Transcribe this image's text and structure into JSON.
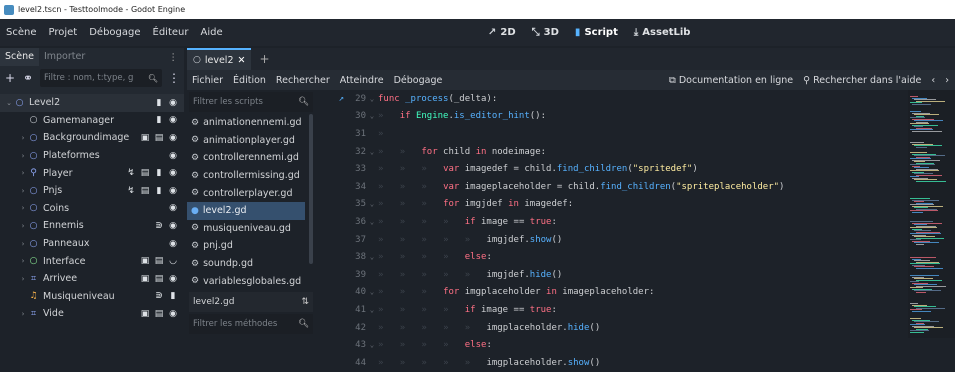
{
  "window": {
    "title": "level2.tscn - Testtoolmode - Godot Engine"
  },
  "menu": [
    "Scène",
    "Projet",
    "Débogage",
    "Éditeur",
    "Aide"
  ],
  "main_screens": [
    {
      "label": "2D",
      "icon": "2d-icon"
    },
    {
      "label": "3D",
      "icon": "3d-icon"
    },
    {
      "label": "Script",
      "icon": "script-icon",
      "active": true
    },
    {
      "label": "AssetLib",
      "icon": "assetlib-icon"
    }
  ],
  "scene_dock": {
    "tabs": [
      "Scène",
      "Importer"
    ],
    "filter_placeholder": "Filtre : nom, t:type, g",
    "nodes": [
      {
        "name": "Level2",
        "icon_color": "#8da5f3"
      },
      {
        "name": "Gamemanager",
        "icon_color": "#cfd3d8"
      },
      {
        "name": "Backgroundimage",
        "icon_color": "#8da5f3"
      },
      {
        "name": "Plateformes",
        "icon_color": "#8da5f3"
      },
      {
        "name": "Player",
        "icon_color": "#8da5f3"
      },
      {
        "name": "Pnjs",
        "icon_color": "#8da5f3"
      },
      {
        "name": "Coins",
        "icon_color": "#8da5f3"
      },
      {
        "name": "Ennemis",
        "icon_color": "#8da5f3"
      },
      {
        "name": "Panneaux",
        "icon_color": "#8da5f3"
      },
      {
        "name": "Interface",
        "icon_color": "#8eef97"
      },
      {
        "name": "Arrivee",
        "icon_color": "#8da5f3"
      },
      {
        "name": "Musiqueniveau",
        "icon_color": "#ffb84d"
      },
      {
        "name": "Vide",
        "icon_color": "#8da5f3"
      }
    ]
  },
  "editor_tabs": [
    {
      "label": "level2"
    }
  ],
  "script_menu": {
    "items": [
      "Fichier",
      "Édition",
      "Rechercher",
      "Atteindre",
      "Débogage"
    ],
    "online_docs": "Documentation en ligne",
    "search_help": "Rechercher dans l'aide"
  },
  "script_list": {
    "filter_placeholder": "Filtrer les scripts",
    "items": [
      "animationennemi.gd",
      "animationplayer.gd",
      "controllerennemi.gd",
      "controllermissing.gd",
      "controllerplayer.gd",
      "level2.gd",
      "musiqueniveau.gd",
      "pnj.gd",
      "soundp.gd",
      "variablesglobales.gd"
    ],
    "selected": "level2.gd",
    "current": "level2.gd",
    "methods_placeholder": "Filtrer les méthodes"
  },
  "code": {
    "first_line": 29,
    "lines": [
      "func _process(_delta):",
      "if Engine.is_editor_hint():",
      "",
      "for child in nodeimage:",
      "var imagedef = child.find_children(\"spritedef\")",
      "var imageplaceholder = child.find_children(\"spriteplaceholder\")",
      "for imgjdef in imagedef:",
      "if image == true:",
      "imgjdef.show()",
      "else:",
      "imgjdef.hide()",
      "for imgplaceholder in imageplaceholder:",
      "if image == true:",
      "imgplaceholder.hide()",
      "else:",
      "imgplaceholder.show()"
    ]
  },
  "colors": {
    "accent": "#57b3ff",
    "keyword": "#ff7085",
    "string": "#ffeda1",
    "class": "#42ffc2"
  }
}
